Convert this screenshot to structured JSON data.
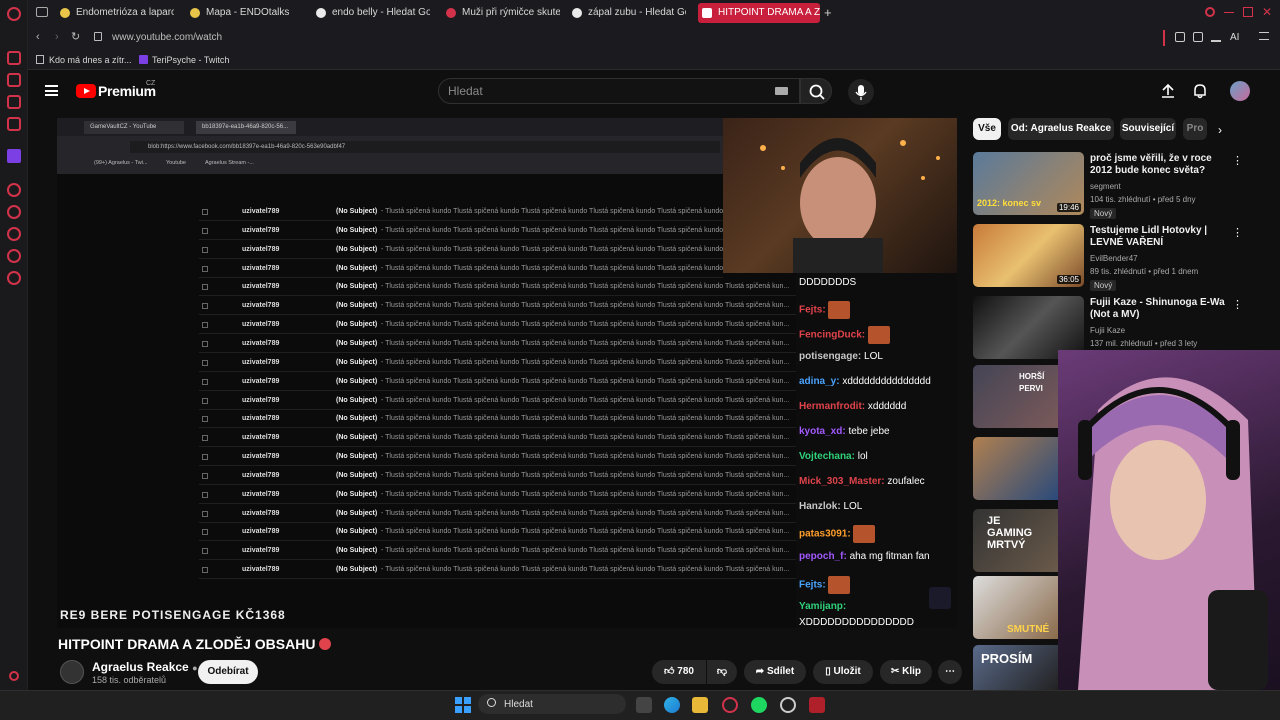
{
  "browser": {
    "tabs": [
      {
        "label": "Endometrióza a laparoskop"
      },
      {
        "label": "Mapa - ENDOtalks"
      },
      {
        "label": "endo belly - Hledat Googl"
      },
      {
        "label": "Muži při rýmičce skutečně"
      },
      {
        "label": "zápal zubu - Hledat Googl"
      },
      {
        "label": "HITPOINT DRAMA A ZLODĚ"
      }
    ],
    "new_tab": "+",
    "url": "www.youtube.com/watch",
    "ai_label": "AI",
    "bookmarks": [
      {
        "label": "Kdo má dnes a zítr..."
      },
      {
        "label": "TeriPsyche - Twitch"
      }
    ]
  },
  "youtube": {
    "logo_text": "Premium",
    "logo_region": "CZ",
    "search_placeholder": "Hledat"
  },
  "video": {
    "inner_tabs": [
      "GameVaultCZ - YouTube",
      "bb18397e-ea1b-46a9-820c-56..."
    ],
    "inner_url": "blob:https://www.facebook.com/bb18397e-ea1b-46a9-820c-563e90adbf47",
    "inner_bookmarks": [
      "(99+) Agraelus - Twi...",
      "Youtube",
      "Agraelus Stream -..."
    ],
    "mail_rows": [
      {
        "user": "uzivatel789",
        "subject": "(No Subject)",
        "body": "- Tlustá spičená kundo Tlustá spičená kundo Tlustá spičená kundo Tlustá spičená kundo Tlustá spičená kundo Tlustá spičená kun..."
      },
      {
        "user": "uzivatel789",
        "subject": "(No Subject)",
        "body": "- Tlustá spičená kundo Tlustá spičená kundo Tlustá spičená kundo Tlustá spičená kundo Tlustá spičená kundo Tlustá spičená kun..."
      },
      {
        "user": "uzivatel789",
        "subject": "(No Subject)",
        "body": "- Tlustá spičená kundo Tlustá spičená kundo Tlustá spičená kundo Tlustá spičená kundo Tlustá spičená kundo Tlustá spičená kun..."
      },
      {
        "user": "uzivatel789",
        "subject": "(No Subject)",
        "body": "- Tlustá spičená kundo Tlustá spičená kundo Tlustá spičená kundo Tlustá spičená kundo Tlustá spičená kundo Tlustá spičená kun..."
      },
      {
        "user": "uzivatel789",
        "subject": "(No Subject)",
        "body": "- Tlustá spičená kundo Tlustá spičená kundo Tlustá spičená kundo Tlustá spičená kundo Tlustá spičená kundo Tlustá spičená kun..."
      },
      {
        "user": "uzivatel789",
        "subject": "(No Subject)",
        "body": "- Tlustá spičená kundo Tlustá spičená kundo Tlustá spičená kundo Tlustá spičená kundo Tlustá spičená kundo Tlustá spičená kun..."
      },
      {
        "user": "uzivatel789",
        "subject": "(No Subject)",
        "body": "- Tlustá spičená kundo Tlustá spičená kundo Tlustá spičená kundo Tlustá spičená kundo Tlustá spičená kundo Tlustá spičená kun..."
      },
      {
        "user": "uzivatel789",
        "subject": "(No Subject)",
        "body": "- Tlustá spičená kundo Tlustá spičená kundo Tlustá spičená kundo Tlustá spičená kundo Tlustá spičená kundo Tlustá spičená kun..."
      },
      {
        "user": "uzivatel789",
        "subject": "(No Subject)",
        "body": "- Tlustá spičená kundo Tlustá spičená kundo Tlustá spičená kundo Tlustá spičená kundo Tlustá spičená kundo Tlustá spičená kun..."
      },
      {
        "user": "uzivatel789",
        "subject": "(No Subject)",
        "body": "- Tlustá spičená kundo Tlustá spičená kundo Tlustá spičená kundo Tlustá spičená kundo Tlustá spičená kundo Tlustá spičená kun..."
      },
      {
        "user": "uzivatel789",
        "subject": "(No Subject)",
        "body": "- Tlustá spičená kundo Tlustá spičená kundo Tlustá spičená kundo Tlustá spičená kundo Tlustá spičená kundo Tlustá spičená kun..."
      },
      {
        "user": "uzivatel789",
        "subject": "(No Subject)",
        "body": "- Tlustá spičená kundo Tlustá spičená kundo Tlustá spičená kundo Tlustá spičená kundo Tlustá spičená kundo Tlustá spičená kun..."
      },
      {
        "user": "uzivatel789",
        "subject": "(No Subject)",
        "body": "- Tlustá spičená kundo Tlustá spičená kundo Tlustá spičená kundo Tlustá spičená kundo Tlustá spičená kundo Tlustá spičená kun..."
      },
      {
        "user": "uzivatel789",
        "subject": "(No Subject)",
        "body": "- Tlustá spičená kundo Tlustá spičená kundo Tlustá spičená kundo Tlustá spičená kundo Tlustá spičená kundo Tlustá spičená kun..."
      },
      {
        "user": "uzivatel789",
        "subject": "(No Subject)",
        "body": "- Tlustá spičená kundo Tlustá spičená kundo Tlustá spičená kundo Tlustá spičená kundo Tlustá spičená kundo Tlustá spičená kun..."
      },
      {
        "user": "uzivatel789",
        "subject": "(No Subject)",
        "body": "- Tlustá spičená kundo Tlustá spičená kundo Tlustá spičená kundo Tlustá spičená kundo Tlustá spičená kundo Tlustá spičená kun..."
      },
      {
        "user": "uzivatel789",
        "subject": "(No Subject)",
        "body": "- Tlustá spičená kundo Tlustá spičená kundo Tlustá spičená kundo Tlustá spičená kundo Tlustá spičená kundo Tlustá spičená kun..."
      },
      {
        "user": "uzivatel789",
        "subject": "(No Subject)",
        "body": "- Tlustá spičená kundo Tlustá spičená kundo Tlustá spičená kundo Tlustá spičená kundo Tlustá spičená kundo Tlustá spičená kun..."
      },
      {
        "user": "uzivatel789",
        "subject": "(No Subject)",
        "body": "- Tlustá spičená kundo Tlustá spičená kundo Tlustá spičená kundo Tlustá spičená kundo Tlustá spičená kundo Tlustá spičená kun..."
      },
      {
        "user": "uzivatel789",
        "subject": "(No Subject)",
        "body": "- Tlustá spičená kundo Tlustá spičená kundo Tlustá spičená kundo Tlustá spičená kundo Tlustá spičená kundo Tlustá spičená kun..."
      }
    ],
    "chat": [
      {
        "name": "",
        "text": "DDDDDDDS",
        "color": "#ffffff",
        "emote": false
      },
      {
        "name": "Fejts:",
        "text": "",
        "color": "#e0434b",
        "emote": true
      },
      {
        "name": "FencingDuck:",
        "text": "",
        "color": "#e0434b",
        "emote": true
      },
      {
        "name": "potisengage:",
        "text": "LOL",
        "color": "#c8c8c8",
        "emote": false
      },
      {
        "name": "adina_y:",
        "text": "xddddddddddddddd",
        "color": "#4aa3ff",
        "emote": false
      },
      {
        "name": "Hermanfrodit:",
        "text": "xdddddd",
        "color": "#e0434b",
        "emote": false
      },
      {
        "name": "kyota_xd:",
        "text": "tebe jebe",
        "color": "#a259ff",
        "emote": false
      },
      {
        "name": "Vojtechana:",
        "text": "lol",
        "color": "#2fd17a",
        "emote": false
      },
      {
        "name": "Mick_303_Master:",
        "text": "zoufalec",
        "color": "#e0434b",
        "emote": false
      },
      {
        "name": "Hanzlok:",
        "text": "LOL",
        "color": "#c8c8c8",
        "emote": false
      },
      {
        "name": "patas3091:",
        "text": "",
        "color": "#ff9e2c",
        "emote": true
      },
      {
        "name": "pepoch_f:",
        "text": "aha mg fitman fan",
        "color": "#a259ff",
        "emote": false
      },
      {
        "name": "Fejts:",
        "text": "",
        "color": "#4aa3ff",
        "emote": true
      },
      {
        "name": "Yamijanp:",
        "text": "",
        "color": "#2fd17a",
        "emote": false
      },
      {
        "name": "",
        "text": "XDDDDDDDDDDDDDDD",
        "color": "#ffffff",
        "emote": false
      }
    ],
    "ticker": "RE9 BERE POTISENGAGE KČ1368"
  },
  "watch": {
    "title": "HITPOINT DRAMA A ZLODĚJ OBSAHU",
    "channel": "Agraelus Reakce",
    "subscribers": "158 tis. odběratelů",
    "subscribe_label": "Odebírat",
    "likes": "780",
    "share_label": "Sdílet",
    "save_label": "Uložit",
    "clip_label": "Klip"
  },
  "sidebar": {
    "chips": [
      "Vše",
      "Od: Agraelus Reakce",
      "Související",
      "Pro"
    ],
    "recommendations": [
      {
        "title": "proč jsme věřili, že v roce 2012 bude konec světa?",
        "channel": "segment",
        "meta": "104 tis. zhlédnutí • před 5 dny",
        "duration": "19:46",
        "badge": "Nový",
        "thumb_text": "2012: konec sv"
      },
      {
        "title": "Testujeme Lidl Hotovky | LEVNÉ VAŘENÍ",
        "channel": "EvilBender47",
        "meta": "89 tis. zhlédnutí • před 1 dnem",
        "duration": "36:05",
        "badge": "Nový",
        "thumb_text": ""
      },
      {
        "title": "Fujii Kaze - Shinunoga E-Wa (Not a MV)",
        "channel": "Fujii Kaze",
        "meta": "137 mil. zhlédnutí • před 3 lety",
        "duration": "",
        "badge": "",
        "thumb_text": ""
      }
    ],
    "partial_thumbs": [
      "HORŠÍ PERVI",
      "",
      "JE GAMING MRTVÝ",
      "SMUTNÉ",
      "PROSÍM"
    ]
  },
  "taskbar": {
    "search_label": "Hledat"
  },
  "colors": {
    "accent": "#c81f3c",
    "yt_red": "#ff0000",
    "bg": "#0f0f0f"
  }
}
